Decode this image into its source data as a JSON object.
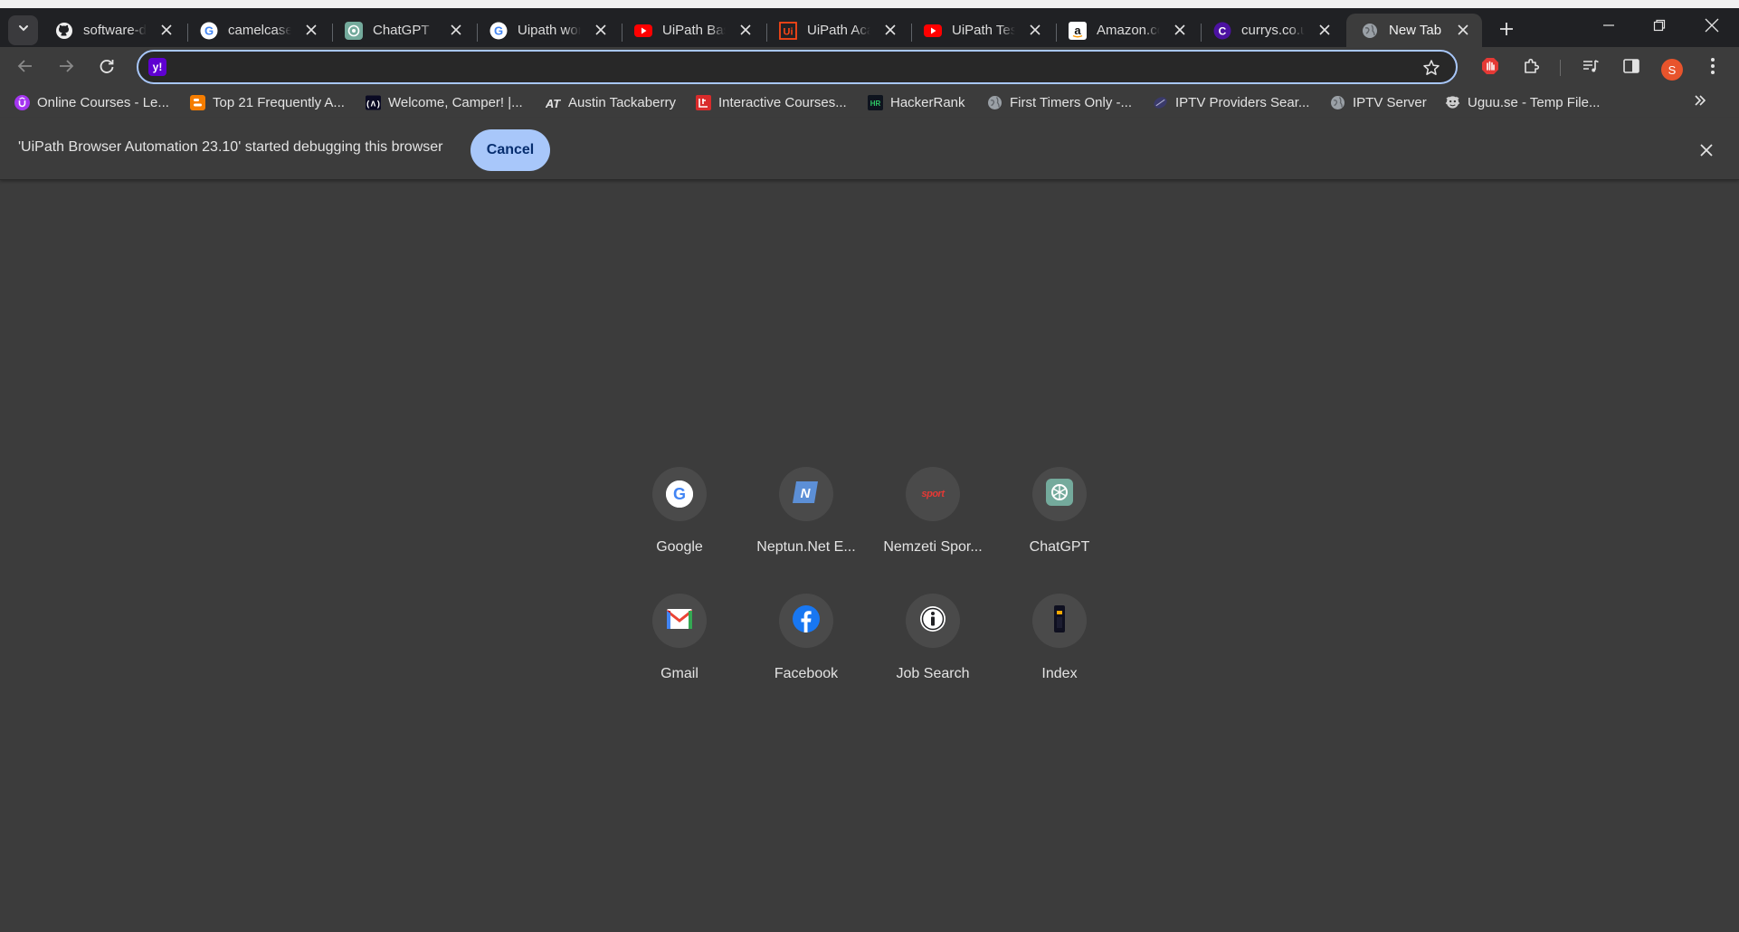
{
  "tabs": [
    {
      "title": "software-d",
      "icon": "github-icon"
    },
    {
      "title": "camelcase",
      "icon": "google-icon"
    },
    {
      "title": "ChatGPT",
      "icon": "chatgpt-icon"
    },
    {
      "title": "Uipath wor",
      "icon": "google-icon"
    },
    {
      "title": "UiPath Bas",
      "icon": "youtube-icon"
    },
    {
      "title": "UiPath Aca",
      "icon": "uipath-icon"
    },
    {
      "title": "UiPath Test",
      "icon": "youtube-icon"
    },
    {
      "title": "Amazon.co",
      "icon": "amazon-icon"
    },
    {
      "title": "currys.co.u",
      "icon": "currys-icon"
    },
    {
      "title": "New Tab",
      "icon": "globe-icon",
      "active": true
    }
  ],
  "omnibox": {
    "value": "",
    "placeholder": "",
    "engine_icon": "yahoo-icon"
  },
  "profile": {
    "initial": "S",
    "color": "#e8542c"
  },
  "bookmarks": [
    {
      "label": "Online Courses - Le...",
      "icon": "udemy-icon"
    },
    {
      "label": "Top 21 Frequently A...",
      "icon": "blogger-icon"
    },
    {
      "label": "Welcome, Camper! |...",
      "icon": "freecodecamp-icon"
    },
    {
      "label": "Austin Tackaberry",
      "icon": "at-logo-icon"
    },
    {
      "label": "Interactive Courses...",
      "icon": "courses-icon"
    },
    {
      "label": "HackerRank",
      "icon": "hackerrank-icon"
    },
    {
      "label": "First Timers Only -...",
      "icon": "globe-icon"
    },
    {
      "label": "IPTV Providers Sear...",
      "icon": "iptv-icon"
    },
    {
      "label": "IPTV Server",
      "icon": "globe-icon"
    },
    {
      "label": "Uguu.se - Temp File...",
      "icon": "uguu-icon"
    }
  ],
  "infobar": {
    "message": "'UiPath Browser Automation 23.10' started debugging this browser",
    "cancel_label": "Cancel"
  },
  "shortcuts": [
    {
      "label": "Google",
      "icon": "google-icon"
    },
    {
      "label": "Neptun.Net E...",
      "icon": "neptun-icon"
    },
    {
      "label": "Nemzeti Spor...",
      "icon": "nemzeti-sport-icon",
      "icon_text": "sport"
    },
    {
      "label": "ChatGPT",
      "icon": "chatgpt-icon"
    },
    {
      "label": "Gmail",
      "icon": "gmail-icon"
    },
    {
      "label": "Facebook",
      "icon": "facebook-icon"
    },
    {
      "label": "Job Search",
      "icon": "info-icon"
    },
    {
      "label": "Index",
      "icon": "index-icon"
    }
  ],
  "colors": {
    "accent": "#a8c7fa",
    "tabstrip": "#202124",
    "surface": "#3c3c3c"
  }
}
